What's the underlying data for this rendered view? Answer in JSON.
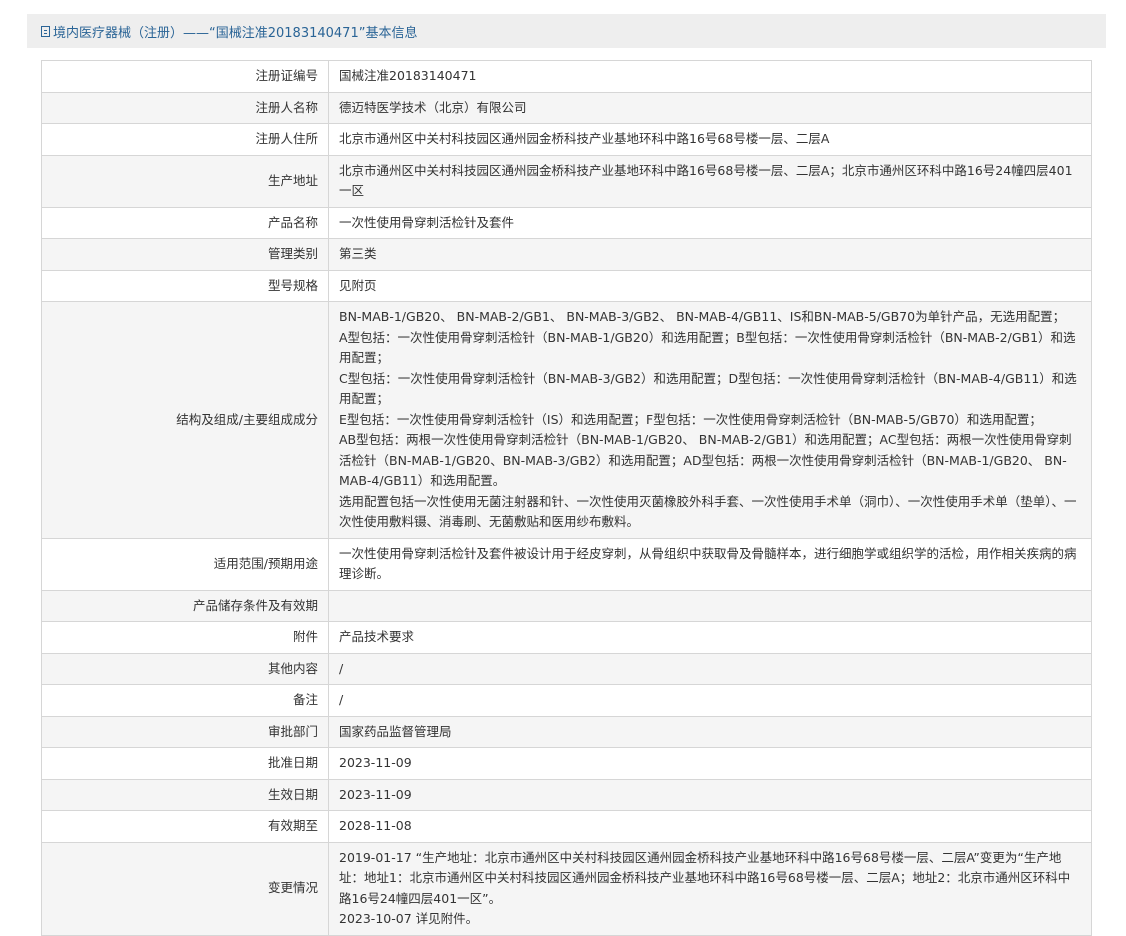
{
  "header": {
    "title": "境内医疗器械（注册）——“国械注准20183140471”基本信息",
    "icon": "document-icon"
  },
  "rows": [
    {
      "label": "注册证编号",
      "value": "国械注准20183140471"
    },
    {
      "label": "注册人名称",
      "value": "德迈特医学技术（北京）有限公司"
    },
    {
      "label": "注册人住所",
      "value": "北京市通州区中关村科技园区通州园金桥科技产业基地环科中路16号68号楼一层、二层A"
    },
    {
      "label": "生产地址",
      "value": "北京市通州区中关村科技园区通州园金桥科技产业基地环科中路16号68号楼一层、二层A；北京市通州区环科中路16号24幢四层401一区"
    },
    {
      "label": "产品名称",
      "value": "一次性使用骨穿刺活检针及套件"
    },
    {
      "label": "管理类别",
      "value": "第三类"
    },
    {
      "label": "型号规格",
      "value": "见附页"
    },
    {
      "label": "结构及组成/主要组成成分",
      "lines": [
        "BN-MAB-1/GB20、 BN-MAB-2/GB1、 BN-MAB-3/GB2、 BN-MAB-4/GB11、IS和BN-MAB-5/GB70为单针产品，无选用配置；",
        "A型包括：一次性使用骨穿刺活检针（BN-MAB-1/GB20）和选用配置；B型包括：一次性使用骨穿刺活检针（BN-MAB-2/GB1）和选用配置；",
        "C型包括：一次性使用骨穿刺活检针（BN-MAB-3/GB2）和选用配置；D型包括：一次性使用骨穿刺活检针（BN-MAB-4/GB11）和选用配置；",
        "E型包括：一次性使用骨穿刺活检针（IS）和选用配置；F型包括：一次性使用骨穿刺活检针（BN-MAB-5/GB70）和选用配置；",
        "AB型包括：两根一次性使用骨穿刺活检针（BN-MAB-1/GB20、 BN-MAB-2/GB1）和选用配置；AC型包括：两根一次性使用骨穿刺活检针（BN-MAB-1/GB20、BN-MAB-3/GB2）和选用配置；AD型包括：两根一次性使用骨穿刺活检针（BN-MAB-1/GB20、 BN-MAB-4/GB11）和选用配置。",
        "选用配置包括一次性使用无菌注射器和针、一次性使用灭菌橡胶外科手套、一次性使用手术单（洞巾）、一次性使用手术单（垫单）、一次性使用敷料镊、消毒刷、无菌敷贴和医用纱布敷料。"
      ]
    },
    {
      "label": "适用范围/预期用途",
      "value": "一次性使用骨穿刺活检针及套件被设计用于经皮穿刺，从骨组织中获取骨及骨髓样本，进行细胞学或组织学的活检，用作相关疾病的病理诊断。"
    },
    {
      "label": "产品储存条件及有效期",
      "value": ""
    },
    {
      "label": "附件",
      "value": "产品技术要求"
    },
    {
      "label": "其他内容",
      "value": "/"
    },
    {
      "label": "备注",
      "value": "/"
    },
    {
      "label": "审批部门",
      "value": "国家药品监督管理局"
    },
    {
      "label": "批准日期",
      "value": "2023-11-09"
    },
    {
      "label": "生效日期",
      "value": "2023-11-09"
    },
    {
      "label": "有效期至",
      "value": "2028-11-08"
    },
    {
      "label": "变更情况",
      "lines": [
        "2019-01-17 “生产地址：北京市通州区中关村科技园区通州园金桥科技产业基地环科中路16号68号楼一层、二层A”变更为“生产地址：地址1：北京市通州区中关村科技园区通州园金桥科技产业基地环科中路16号68号楼一层、二层A；地址2：北京市通州区环科中路16号24幢四层401一区”。",
        "2023-10-07 详见附件。"
      ]
    }
  ]
}
